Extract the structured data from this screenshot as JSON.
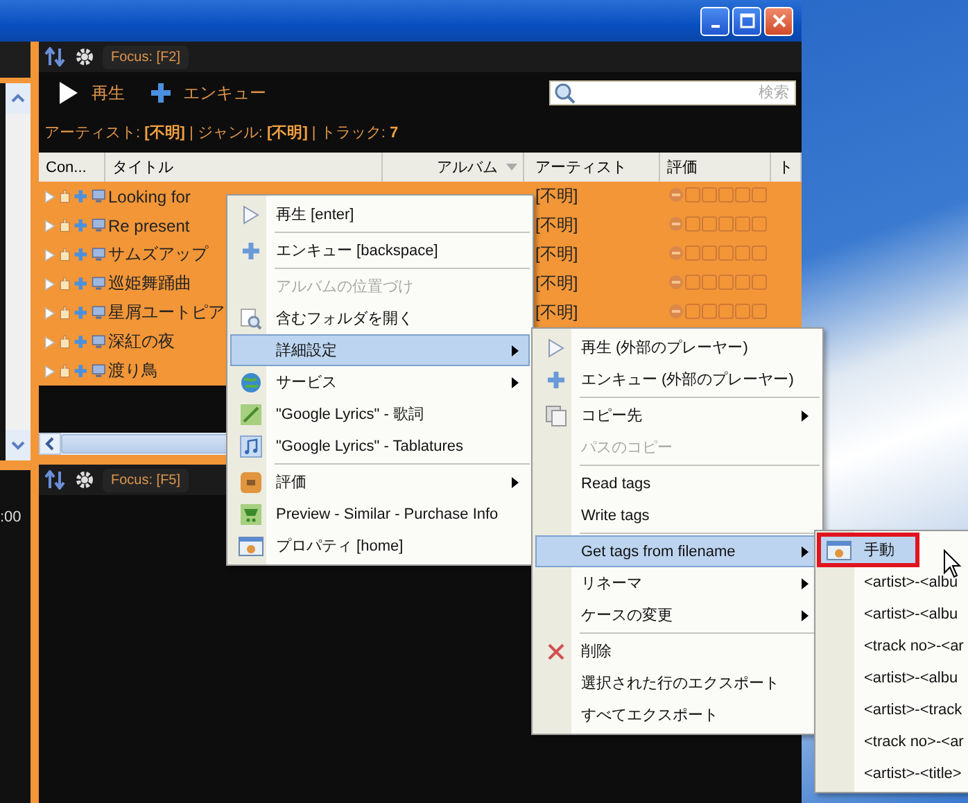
{
  "left_panel": {
    "time": ":00"
  },
  "top_panel": {
    "focus": "Focus: [F2]",
    "toolbar": [
      {
        "label": "再生",
        "kind": "play"
      },
      {
        "label": "エンキュー",
        "kind": "enqueue"
      }
    ],
    "search": {
      "placeholder": "検索"
    },
    "info": "アーティスト: **[不明]** | ジャンル: **[不明]** | トラック: **7**",
    "columns": [
      {
        "label": "Con...",
        "sorted": false
      },
      {
        "label": "タイトル",
        "sorted": false
      },
      {
        "label": "アルバム",
        "sorted": true
      },
      {
        "label": "アーティスト",
        "sorted": false
      },
      {
        "label": "評価",
        "sorted": false
      },
      {
        "label": "ト",
        "sorted": false
      }
    ],
    "rows": [
      {
        "title": "Looking for",
        "artist": "[不明]",
        "stars": 0
      },
      {
        "title": "Re present",
        "artist": "[不明]",
        "stars": 0
      },
      {
        "title": "サムズアップ",
        "artist": "[不明]",
        "stars": 0
      },
      {
        "title": "巡姫舞踊曲",
        "artist": "[不明]",
        "stars": 0
      },
      {
        "title": "星屑ユートピア",
        "artist": "[不明]",
        "stars": 0
      },
      {
        "title": "深紅の夜"
      },
      {
        "title": "渡り鳥"
      }
    ]
  },
  "bottom_panel": {
    "focus": "Focus: [F5]"
  },
  "context_menu": {
    "items": [
      {
        "label": "再生 [enter]",
        "kind": "play",
        "selected": false,
        "disabled": false,
        "submenu": false
      },
      {
        "kind": "separator"
      },
      {
        "label": "エンキュー [backspace]",
        "kind": "enqueue",
        "selected": false,
        "disabled": false,
        "submenu": false
      },
      {
        "kind": "separator"
      },
      {
        "label": "アルバムの位置づけ",
        "kind": "plain",
        "selected": false,
        "disabled": true,
        "submenu": false
      },
      {
        "label": "含むフォルダを開く",
        "kind": "folder",
        "selected": false,
        "disabled": false,
        "submenu": false
      },
      {
        "label": "詳細設定",
        "kind": "plain",
        "selected": true,
        "disabled": false,
        "submenu": true
      },
      {
        "label": "サービス",
        "kind": "globe",
        "selected": false,
        "disabled": false,
        "submenu": true
      },
      {
        "label": "\"Google Lyrics\" - 歌詞",
        "kind": "pen",
        "selected": false,
        "disabled": false,
        "submenu": false
      },
      {
        "label": "\"Google Lyrics\" - Tablatures",
        "kind": "music",
        "selected": false,
        "disabled": false,
        "submenu": false
      },
      {
        "kind": "separator"
      },
      {
        "label": "評価",
        "kind": "rating",
        "selected": false,
        "disabled": false,
        "submenu": true
      },
      {
        "label": "Preview - Similar - Purchase Info",
        "kind": "cart",
        "selected": false,
        "disabled": false,
        "submenu": false
      },
      {
        "label": "プロパティ [home]",
        "kind": "properties",
        "selected": false,
        "disabled": false,
        "submenu": false
      }
    ]
  },
  "submenu": {
    "items": [
      {
        "label": "再生 (外部のプレーヤー)",
        "kind": "play",
        "selected": false,
        "disabled": false,
        "submenu": false
      },
      {
        "label": "エンキュー (外部のプレーヤー)",
        "kind": "enqueue",
        "selected": false,
        "disabled": false,
        "submenu": false
      },
      {
        "kind": "separator"
      },
      {
        "label": "コピー先",
        "kind": "copy",
        "selected": false,
        "disabled": false,
        "submenu": true
      },
      {
        "label": "パスのコピー",
        "kind": "plain",
        "selected": false,
        "disabled": true,
        "submenu": false
      },
      {
        "kind": "separator"
      },
      {
        "label": "Read tags",
        "kind": "plain",
        "selected": false,
        "disabled": false,
        "submenu": false
      },
      {
        "label": "Write tags",
        "kind": "plain",
        "selected": false,
        "disabled": false,
        "submenu": false
      },
      {
        "kind": "separator"
      },
      {
        "label": "Get tags from filename",
        "kind": "plain",
        "selected": true,
        "disabled": false,
        "submenu": true
      },
      {
        "label": "リネーマ",
        "kind": "plain",
        "selected": false,
        "disabled": false,
        "submenu": true
      },
      {
        "label": "ケースの変更",
        "kind": "plain",
        "selected": false,
        "disabled": false,
        "submenu": true
      },
      {
        "kind": "separator"
      },
      {
        "label": "削除",
        "kind": "delete",
        "selected": false,
        "disabled": false,
        "submenu": false
      },
      {
        "label": "選択された行のエクスポート",
        "kind": "plain",
        "selected": false,
        "disabled": false,
        "submenu": false
      },
      {
        "label": "すべてエクスポート",
        "kind": "plain",
        "selected": false,
        "disabled": false,
        "submenu": false
      }
    ]
  },
  "submenu_2": {
    "items": [
      {
        "label": "手動",
        "kind": "properties",
        "selected": true,
        "highlighted": true
      },
      {
        "label": "<artist>-<albu",
        "kind": "plain",
        "selected": false,
        "highlighted": false
      },
      {
        "label": "<artist>-<albu",
        "kind": "plain",
        "selected": false,
        "highlighted": false
      },
      {
        "label": "<track no>-<ar",
        "kind": "plain",
        "selected": false,
        "highlighted": false
      },
      {
        "label": "<artist>-<albu",
        "kind": "plain",
        "selected": false,
        "highlighted": false
      },
      {
        "label": "<artist>-<track",
        "kind": "plain",
        "selected": false,
        "highlighted": false
      },
      {
        "label": "<track no>-<ar",
        "kind": "plain",
        "selected": false,
        "highlighted": false
      },
      {
        "label": "<artist>-<title>",
        "kind": "plain",
        "selected": false,
        "highlighted": false
      }
    ]
  }
}
